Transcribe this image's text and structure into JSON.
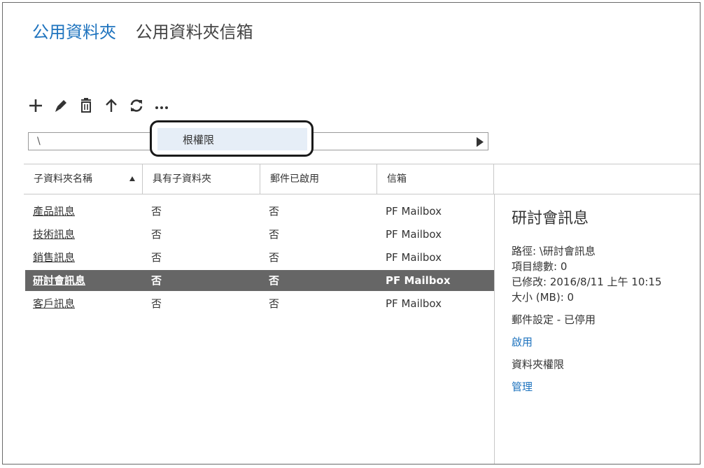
{
  "tabs": [
    {
      "label": "公用資料夾"
    },
    {
      "label": "公用資料夾信箱"
    }
  ],
  "toolbar": {
    "icons": [
      "add-icon",
      "edit-icon",
      "delete-icon",
      "up-icon",
      "refresh-icon",
      "more-icon"
    ]
  },
  "path": {
    "value": "\\"
  },
  "dropdown": {
    "item_label": "根權限"
  },
  "table": {
    "headers": [
      "子資料夾名稱",
      "具有子資料夾",
      "郵件已啟用",
      "信箱"
    ],
    "rows": [
      {
        "name": "產品訊息",
        "has_sub": "否",
        "mail_enabled": "否",
        "mailbox": "PF Mailbox"
      },
      {
        "name": "技術訊息",
        "has_sub": "否",
        "mail_enabled": "否",
        "mailbox": "PF Mailbox"
      },
      {
        "name": "銷售訊息",
        "has_sub": "否",
        "mail_enabled": "否",
        "mailbox": "PF Mailbox"
      },
      {
        "name": "研討會訊息",
        "has_sub": "否",
        "mail_enabled": "否",
        "mailbox": "PF Mailbox"
      },
      {
        "name": "客戶訊息",
        "has_sub": "否",
        "mail_enabled": "否",
        "mailbox": "PF Mailbox"
      }
    ]
  },
  "details": {
    "title": "研討會訊息",
    "path": "路徑: \\研討會訊息",
    "item_count": "項目總數: 0",
    "modified": "已修改: 2016/8/11 上午 10:15",
    "size": "大小 (MB): 0",
    "mail_settings": "郵件設定 - 已停用",
    "enable_link": "啟用",
    "permissions_label": "資料夾權限",
    "manage_link": "管理"
  },
  "colors": {
    "accent": "#1e73be",
    "selected_row": "#666666",
    "dropdown_highlight": "#e6eef7"
  }
}
